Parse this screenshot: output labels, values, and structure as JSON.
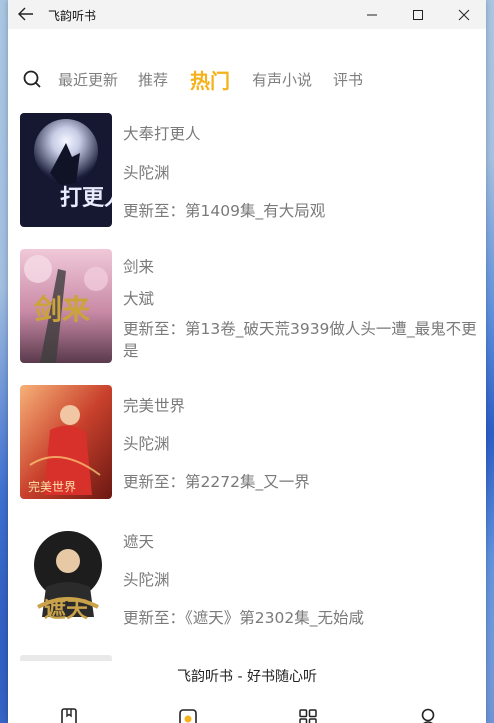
{
  "window": {
    "title": "飞韵听书"
  },
  "categories": [
    {
      "label": "最近更新",
      "active": false
    },
    {
      "label": "推荐",
      "active": false
    },
    {
      "label": "热门",
      "active": true
    },
    {
      "label": "有声小说",
      "active": false
    },
    {
      "label": "评书",
      "active": false
    }
  ],
  "books": [
    {
      "title": "大奉打更人",
      "author": "头陀渊",
      "update": "更新至：第1409集_有大局观",
      "cover_text": "打更人"
    },
    {
      "title": "剑来",
      "author": "大斌",
      "update": "更新至：第13卷_破天荒3939做人头一遭_最鬼不更是",
      "cover_text": "剑来"
    },
    {
      "title": "完美世界",
      "author": "头陀渊",
      "update": "更新至：第2272集_又一界",
      "cover_text": "完美世界"
    },
    {
      "title": "遮天",
      "author": "头陀渊",
      "update": "更新至：《遮天》第2302集_无始咸",
      "cover_text": "遮天"
    }
  ],
  "footer": {
    "slogan": "飞韵听书 - 好书随心听"
  },
  "bottom_nav": [
    {
      "icon": "bookshelf-icon"
    },
    {
      "icon": "listen-icon"
    },
    {
      "icon": "category-grid-icon"
    },
    {
      "icon": "profile-icon"
    }
  ],
  "colors": {
    "accent": "#f5b21a",
    "text_secondary": "#7a7a7a"
  }
}
